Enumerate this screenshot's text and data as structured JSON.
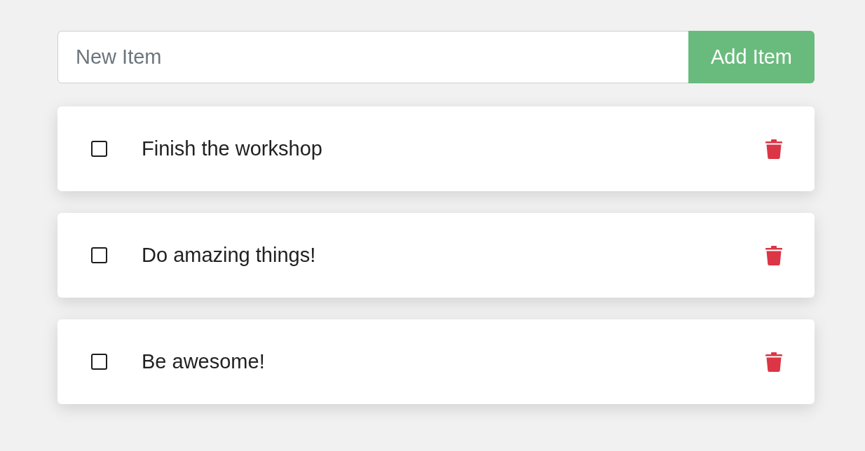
{
  "new_item_field": {
    "placeholder": "New Item"
  },
  "add_button": {
    "label": "Add Item"
  },
  "items": [
    {
      "text": "Finish the workshop",
      "checked": false
    },
    {
      "text": "Do amazing things!",
      "checked": false
    },
    {
      "text": "Be awesome!",
      "checked": false
    }
  ]
}
